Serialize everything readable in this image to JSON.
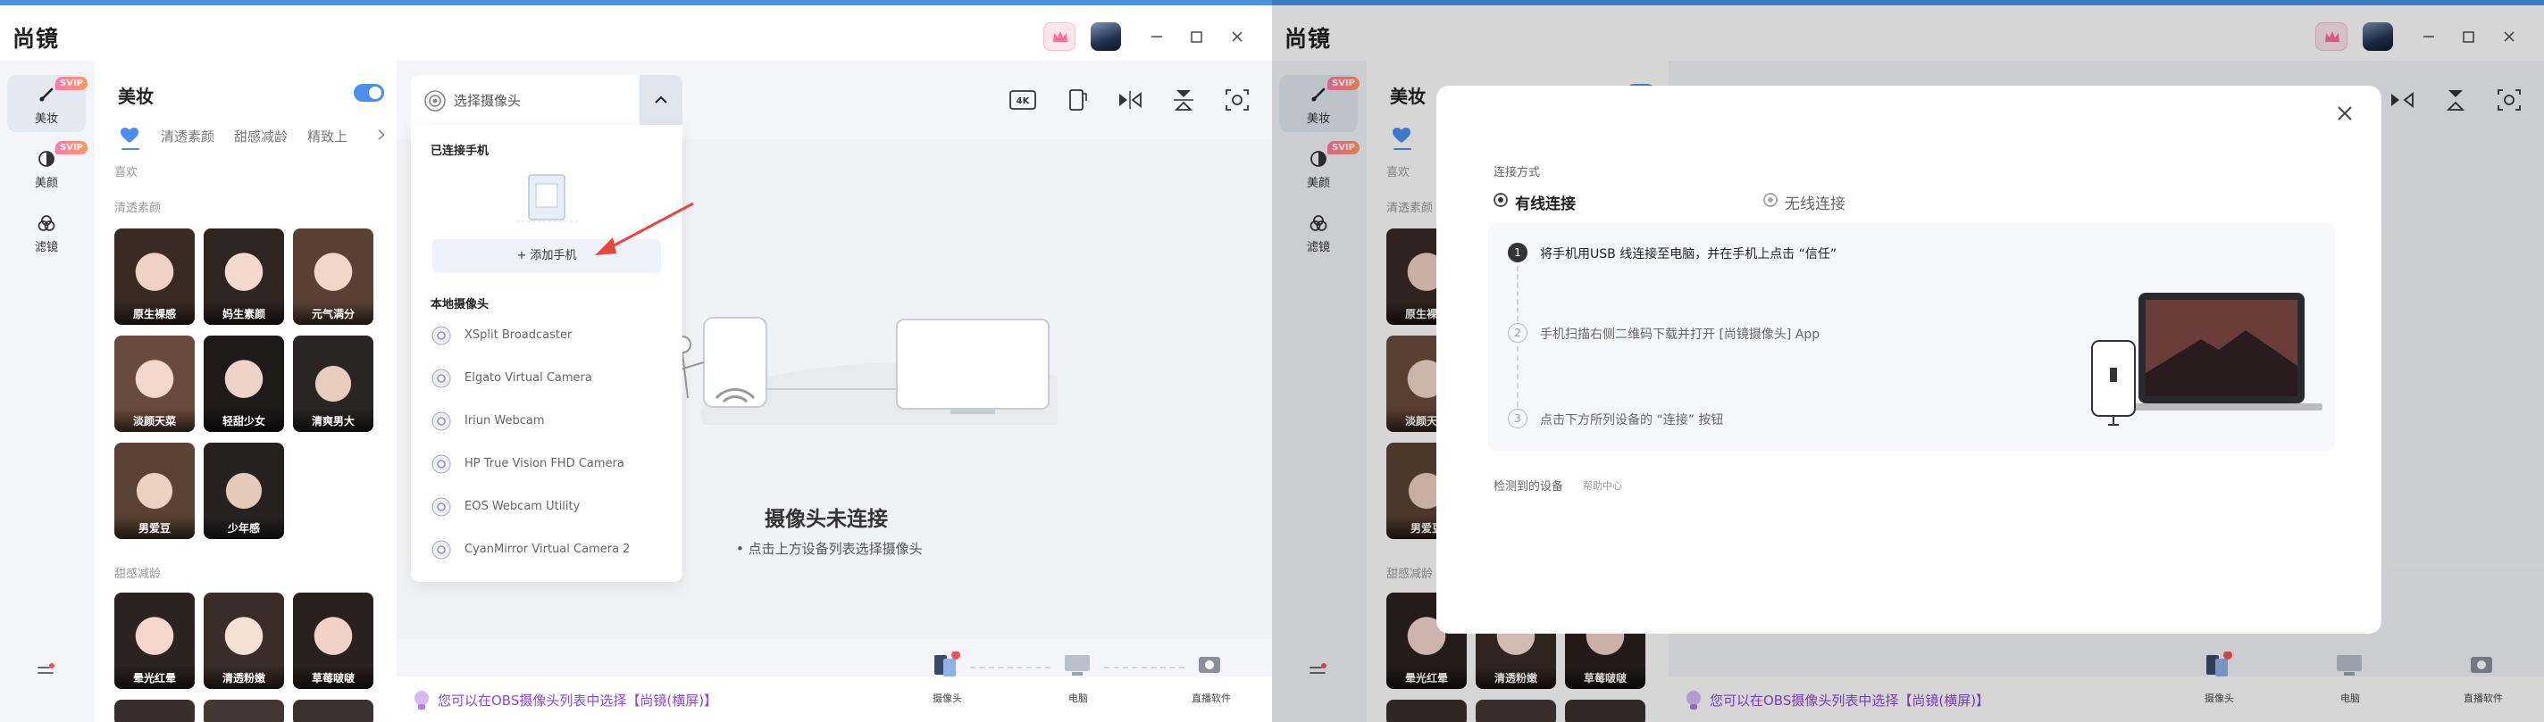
{
  "app": {
    "logo": "尚镜",
    "accent": "#4a90e2"
  },
  "nav": {
    "items": [
      {
        "label": "美妆",
        "badge": "SVIP"
      },
      {
        "label": "美颜",
        "badge": "SVIP"
      },
      {
        "label": "滤镜",
        "badge": ""
      }
    ]
  },
  "panel": {
    "title": "美妆",
    "tabs": [
      "清透素颜",
      "甜感减龄",
      "精致上"
    ],
    "fav_section": "喜欢",
    "sections": [
      {
        "title": "清透素颜",
        "items": [
          "原生裸感",
          "妈生素颜",
          "元气满分",
          "淡颜天菜",
          "轻甜少女",
          "清爽男大",
          "男爱豆",
          "少年感"
        ]
      },
      {
        "title": "甜感减龄",
        "items": [
          "晕光红晕",
          "清透粉嫩",
          "草莓啵啵"
        ]
      }
    ]
  },
  "camera_select": {
    "placeholder": "选择摄像头"
  },
  "dropdown": {
    "connected_title": "已连接手机",
    "add_phone": "+ 添加手机",
    "local_title": "本地摄像头",
    "cameras": [
      "XSplit Broadcaster",
      "Elgato Virtual Camera",
      "Iriun Webcam",
      "HP True Vision FHD Camera",
      "EOS Webcam Utility",
      "CyanMirror Virtual Camera 2"
    ]
  },
  "stage": {
    "title": "摄像头未连接",
    "subtitle": "•  点击上方设备列表选择摄像头"
  },
  "toolbar": {
    "res_label": "4K"
  },
  "bottom": {
    "tip": "您可以在OBS摄像头列表中选择【尚镜(横屏)】",
    "flow": [
      "摄像头",
      "电脑",
      "直播软件"
    ]
  },
  "modal": {
    "method_label": "连接方式",
    "options": [
      {
        "label": "有线连接",
        "selected": true
      },
      {
        "label": "无线连接",
        "selected": false
      }
    ],
    "steps": [
      {
        "num": "1",
        "text": "将手机用USB 线连接至电脑，并在手机上点击 “信任”"
      },
      {
        "num": "2",
        "text": "手机扫描右侧二维码下载并打开 [尚镜摄像头] App"
      },
      {
        "num": "3",
        "text": "点击下方所列设备的 “连接” 按钮"
      }
    ],
    "detected_label": "检测到的设备",
    "help_link": "帮助中心"
  }
}
